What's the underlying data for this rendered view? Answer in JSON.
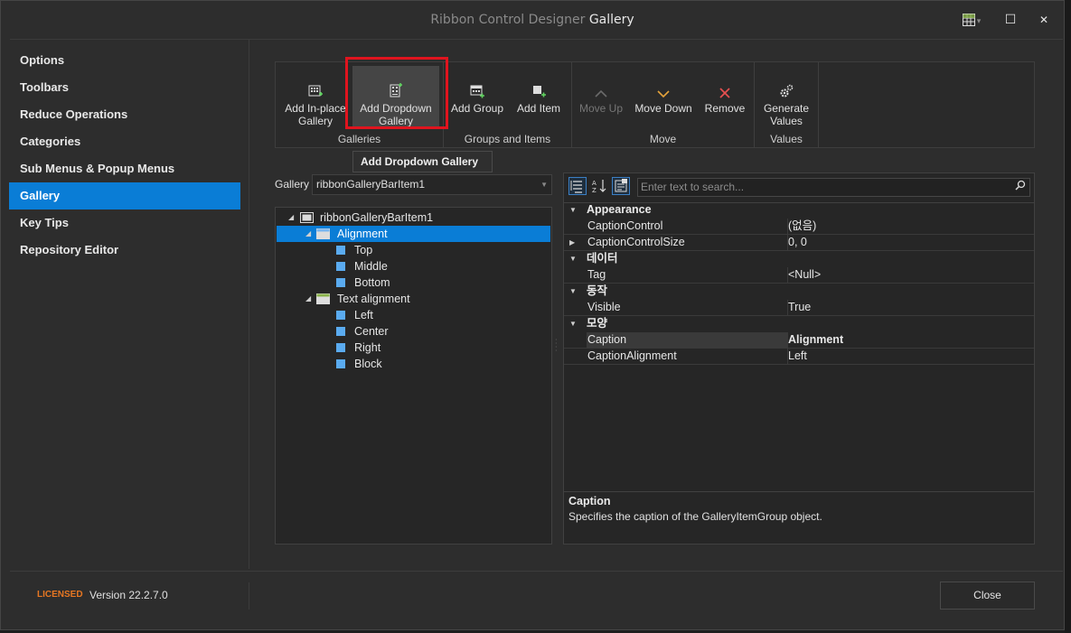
{
  "window": {
    "title_prefix": "Ribbon Control Designer ",
    "title_highlight": "Gallery",
    "maximize_glyph": "☐",
    "close_glyph": "✕",
    "dropdown_glyph": "▾"
  },
  "nav": {
    "items": [
      {
        "label": "Options"
      },
      {
        "label": "Toolbars"
      },
      {
        "label": "Reduce Operations"
      },
      {
        "label": "Categories"
      },
      {
        "label": "Sub Menus & Popup Menus"
      },
      {
        "label": "Gallery",
        "active": true
      },
      {
        "label": "Key Tips"
      },
      {
        "label": "Repository Editor"
      }
    ]
  },
  "ribbon": {
    "groups": [
      {
        "label": "Galleries"
      },
      {
        "label": "Groups and Items"
      },
      {
        "label": "Move"
      },
      {
        "label": "Values"
      }
    ],
    "buttons": {
      "add_inplace": {
        "line1": "Add In-place",
        "line2": "Gallery"
      },
      "add_dropdown": {
        "line1": "Add Dropdown",
        "line2": "Gallery"
      },
      "add_group": {
        "line1": "Add Group"
      },
      "add_item": {
        "line1": "Add Item"
      },
      "move_up": {
        "line1": "Move Up"
      },
      "move_down": {
        "line1": "Move Down"
      },
      "remove": {
        "line1": "Remove"
      },
      "generate": {
        "line1": "Generate",
        "line2": "Values"
      }
    }
  },
  "tooltip": {
    "text": "Add Dropdown Gallery"
  },
  "gallery_select": {
    "label": "Gallery",
    "value": "ribbonGalleryBarItem1"
  },
  "tree": {
    "root": "ribbonGalleryBarItem1",
    "groups": [
      {
        "label": "Alignment",
        "items": [
          "Top",
          "Middle",
          "Bottom"
        ]
      },
      {
        "label": "Text alignment",
        "items": [
          "Left",
          "Center",
          "Right",
          "Block"
        ]
      }
    ]
  },
  "property_grid": {
    "search_placeholder": "Enter text to search...",
    "categories": [
      {
        "name": "Appearance",
        "rows": [
          {
            "name": "CaptionControl",
            "value": "(없음)"
          },
          {
            "name": "CaptionControlSize",
            "value": "0, 0"
          }
        ]
      },
      {
        "name": "데이터",
        "rows": [
          {
            "name": "Tag",
            "value": "<Null>"
          }
        ]
      },
      {
        "name": "동작",
        "rows": [
          {
            "name": "Visible",
            "value": "True"
          }
        ]
      },
      {
        "name": "모양",
        "rows": [
          {
            "name": "Caption",
            "value": "Alignment"
          },
          {
            "name": "CaptionAlignment",
            "value": "Left"
          }
        ]
      }
    ],
    "description": {
      "title": "Caption",
      "text": "Specifies the caption of the GalleryItemGroup object."
    }
  },
  "footer": {
    "licensed": "LICENSED",
    "version": "Version 22.2.7.0",
    "close_label": "Close"
  },
  "colors": {
    "accent": "#0a7dd6",
    "highlight_box": "#e0141e",
    "licensed": "#e87722"
  }
}
